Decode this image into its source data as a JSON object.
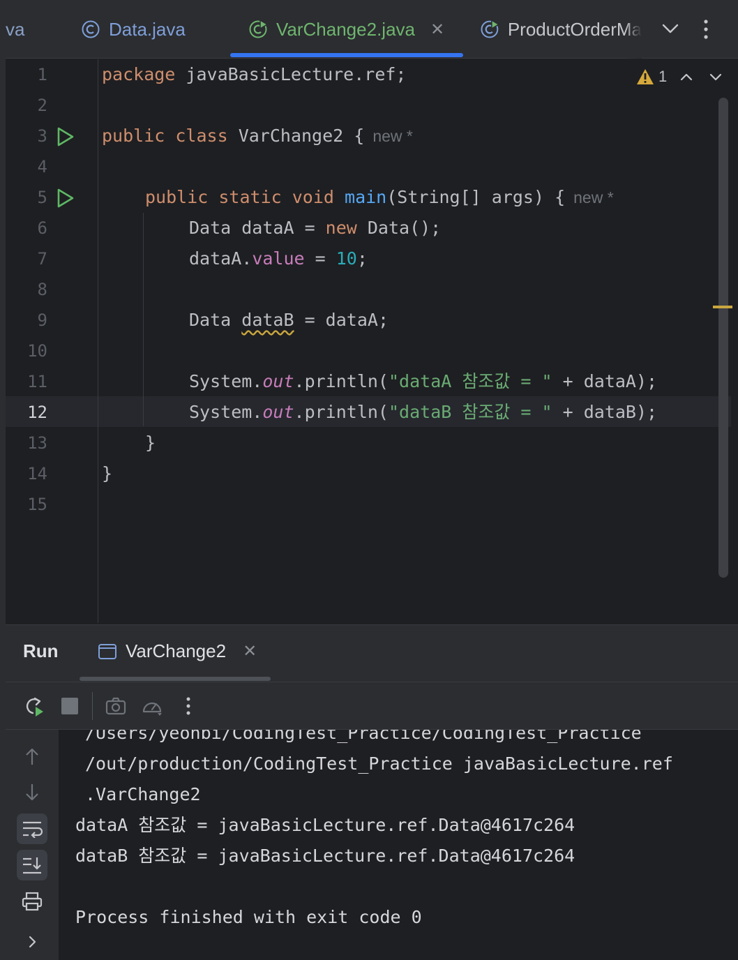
{
  "tabs": {
    "partial_label": "va",
    "data_label": "Data.java",
    "varchange_label": "VarChange2.java",
    "product_label": "ProductOrderMa",
    "close_glyph": "✕"
  },
  "editor": {
    "lines": [
      {
        "n": "1"
      },
      {
        "n": "2"
      },
      {
        "n": "3"
      },
      {
        "n": "4"
      },
      {
        "n": "5"
      },
      {
        "n": "6"
      },
      {
        "n": "7"
      },
      {
        "n": "8"
      },
      {
        "n": "9"
      },
      {
        "n": "10"
      },
      {
        "n": "11"
      },
      {
        "n": "12"
      },
      {
        "n": "13"
      },
      {
        "n": "14"
      },
      {
        "n": "15"
      }
    ],
    "code": {
      "l1_kw": "package",
      "l1_rest": " javaBasicLecture.ref;",
      "l3_kw1": "public",
      "l3_kw2": "class",
      "l3_rest": " VarChange2 {",
      "l5_kw1": "public",
      "l5_kw2": "static",
      "l5_kw3": "void",
      "l5_fn": "main",
      "l5_rest": "(String[] args) {",
      "l6_a": "Data dataA = ",
      "l6_kw": "new",
      "l6_b": " Data();",
      "l7_a": "dataA.",
      "l7_fld": "value",
      "l7_b": " = ",
      "l7_num": "10",
      "l7_c": ";",
      "l9_a": "Data ",
      "l9_var": "dataB",
      "l9_b": " = dataA;",
      "l11_a": "System.",
      "l11_out": "out",
      "l11_b": ".println(",
      "l11_str": "\"dataA 참조값 = \"",
      "l11_c": " + dataA);",
      "l12_a": "System.",
      "l12_out": "out",
      "l12_b": ".println(",
      "l12_str": "\"dataB 참조값 = \"",
      "l12_c": " + dataB);",
      "l13": "}",
      "l14": "}"
    },
    "inlay_new": "new *",
    "warning_count": "1",
    "active_line": "12"
  },
  "run_panel": {
    "title": "Run",
    "tab_label": "VarChange2",
    "close_glyph": "✕",
    "console": [
      "/Users/yeonbi/CodingTest_Practice/CodingTest_Practice",
      "/out/production/CodingTest_Practice javaBasicLecture.ref",
      ".VarChange2",
      "dataA 참조값 = javaBasicLecture.ref.Data@4617c264",
      "dataB 참조값 = javaBasicLecture.ref.Data@4617c264",
      "",
      "Process finished with exit code 0"
    ]
  },
  "colors": {
    "editor_bg": "#1e1f22",
    "panel_bg": "#2b2d30",
    "keyword": "#cf8e6d",
    "function": "#56a8f5",
    "field": "#c77dbb",
    "number": "#2aacb8",
    "string": "#6aab73",
    "accent": "#3574f0"
  },
  "icons": {
    "tab_data": "class-c-icon",
    "tab_varchange": "runnable-class-icon",
    "tab_product": "runnable-class-icon",
    "run_gutter": "run-triangle-icon",
    "warning": "warning-triangle-icon",
    "rerun": "rerun-icon",
    "stop": "stop-icon",
    "screenshot": "camera-icon",
    "profiler": "gauge-icon",
    "more": "more-vertical-icon",
    "up": "arrow-up-icon",
    "down": "arrow-down-icon",
    "softwrap": "soft-wrap-icon",
    "scroll_end": "scroll-to-end-icon",
    "print": "print-icon",
    "expand": "chevron-right-icon"
  }
}
